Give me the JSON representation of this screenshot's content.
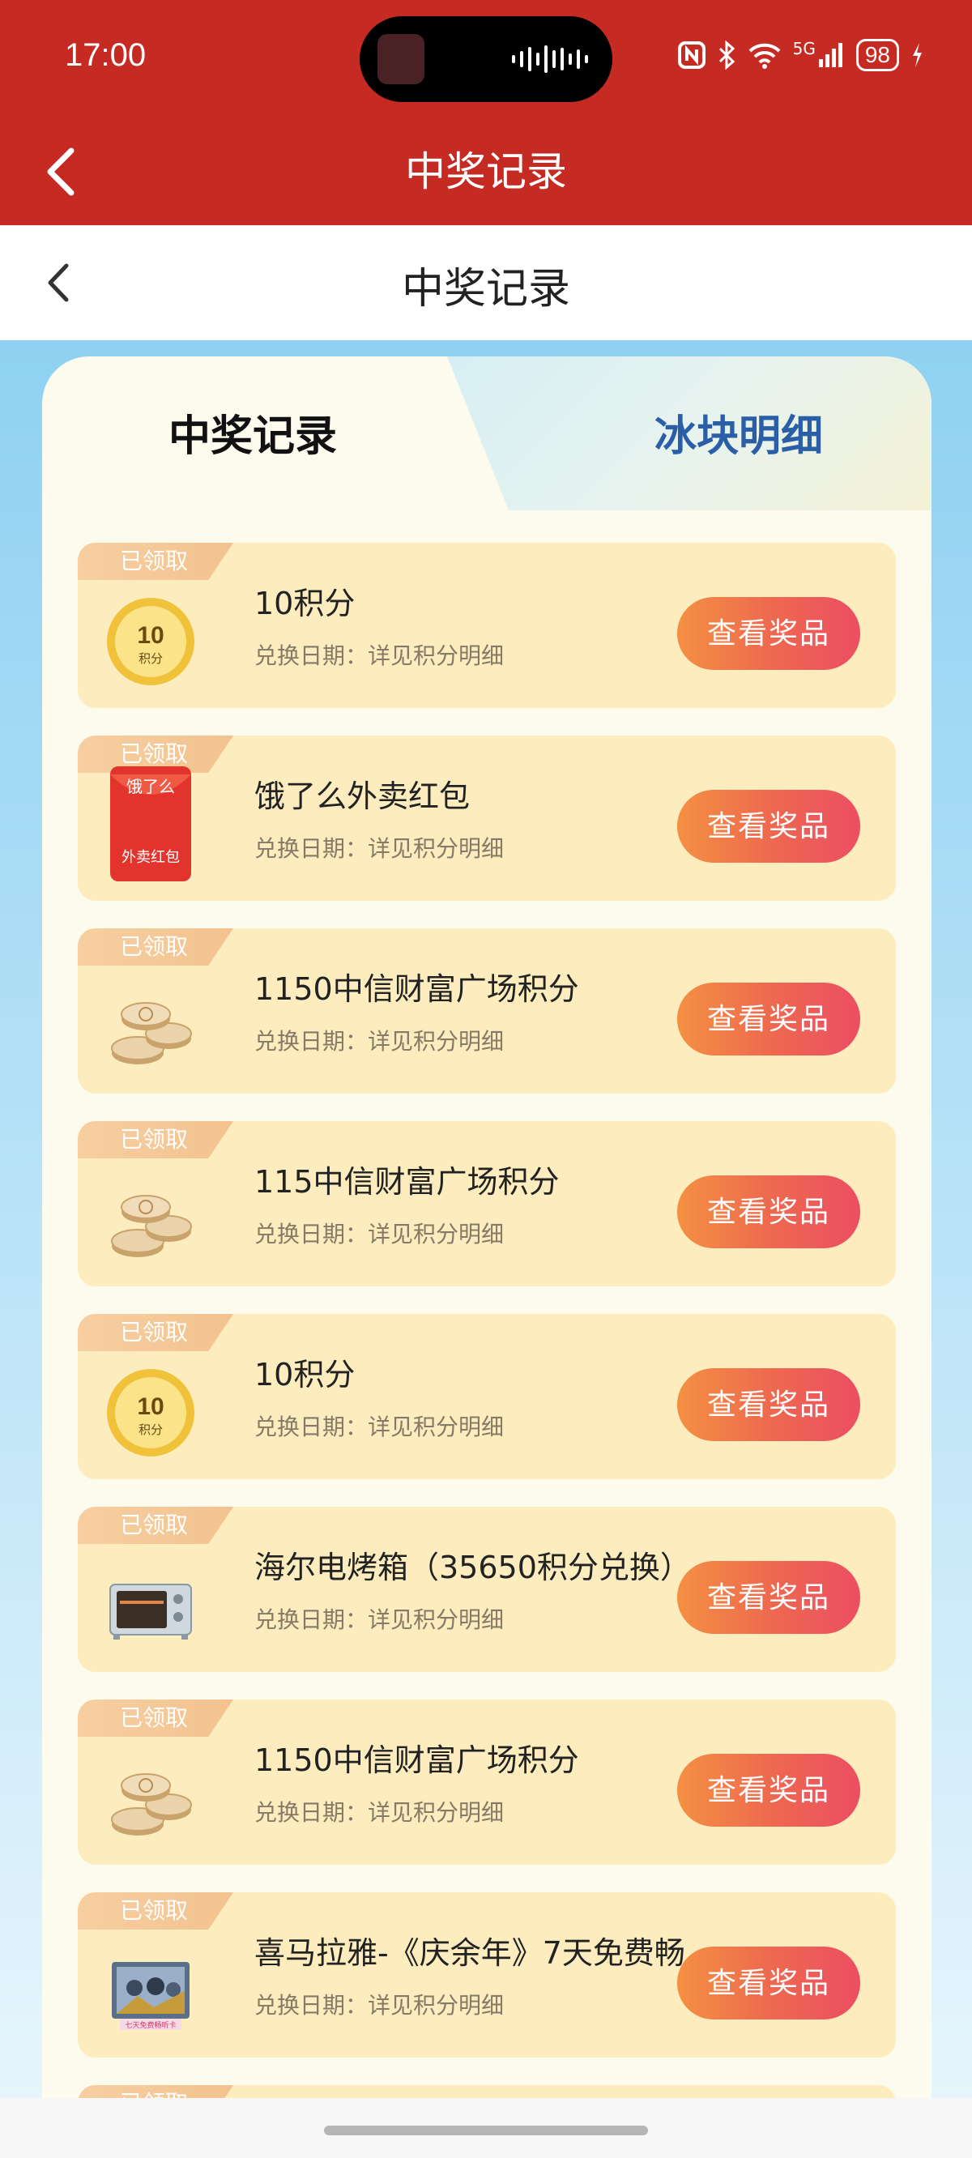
{
  "status_bar": {
    "time": "17:00",
    "battery": "98",
    "network": "5G"
  },
  "app_header": {
    "title": "中奖记录"
  },
  "page_header": {
    "title": "中奖记录"
  },
  "tabs": [
    {
      "label": "中奖记录",
      "active": true
    },
    {
      "label": "冰块明细",
      "active": false
    }
  ],
  "prize_list": [
    {
      "status": "已领取",
      "name": "10积分",
      "date_text": "兑换日期：详见积分明细",
      "button": "查看奖品",
      "icon": "points-coin-icon",
      "coin_value": "10",
      "coin_unit": "积分"
    },
    {
      "status": "已领取",
      "name": "饿了么外卖红包",
      "date_text": "兑换日期：详见积分明细",
      "button": "查看奖品",
      "icon": "red-envelope-icon",
      "envelope_brand": "饿了么",
      "envelope_text": "外卖红包"
    },
    {
      "status": "已领取",
      "name": "1150中信财富广场积分",
      "date_text": "兑换日期：详见积分明细",
      "button": "查看奖品",
      "icon": "coin-stack-icon"
    },
    {
      "status": "已领取",
      "name": "115中信财富广场积分",
      "date_text": "兑换日期：详见积分明细",
      "button": "查看奖品",
      "icon": "coin-stack-icon"
    },
    {
      "status": "已领取",
      "name": "10积分",
      "date_text": "兑换日期：详见积分明细",
      "button": "查看奖品",
      "icon": "points-coin-icon",
      "coin_value": "10",
      "coin_unit": "积分"
    },
    {
      "status": "已领取",
      "name": "海尔电烤箱（35650积分兑换）",
      "date_text": "兑换日期：详见积分明细",
      "button": "查看奖品",
      "icon": "oven-icon"
    },
    {
      "status": "已领取",
      "name": "1150中信财富广场积分",
      "date_text": "兑换日期：详见积分明细",
      "button": "查看奖品",
      "icon": "coin-stack-icon"
    },
    {
      "status": "已领取",
      "name": "喜马拉雅-《庆余年》7天免费畅...",
      "date_text": "兑换日期：详见积分明细",
      "button": "查看奖品",
      "icon": "listening-card-icon",
      "card_caption": "七天免费畅听卡"
    },
    {
      "status": "已领取",
      "name": "",
      "date_text": "",
      "button": "",
      "icon": ""
    }
  ],
  "colors": {
    "header_red": "#c52a23",
    "tab_blue": "#2a5fa8",
    "item_bg": "#fcecbe",
    "button_gradient_start": "#f49042",
    "button_gradient_end": "#ec4d63"
  }
}
